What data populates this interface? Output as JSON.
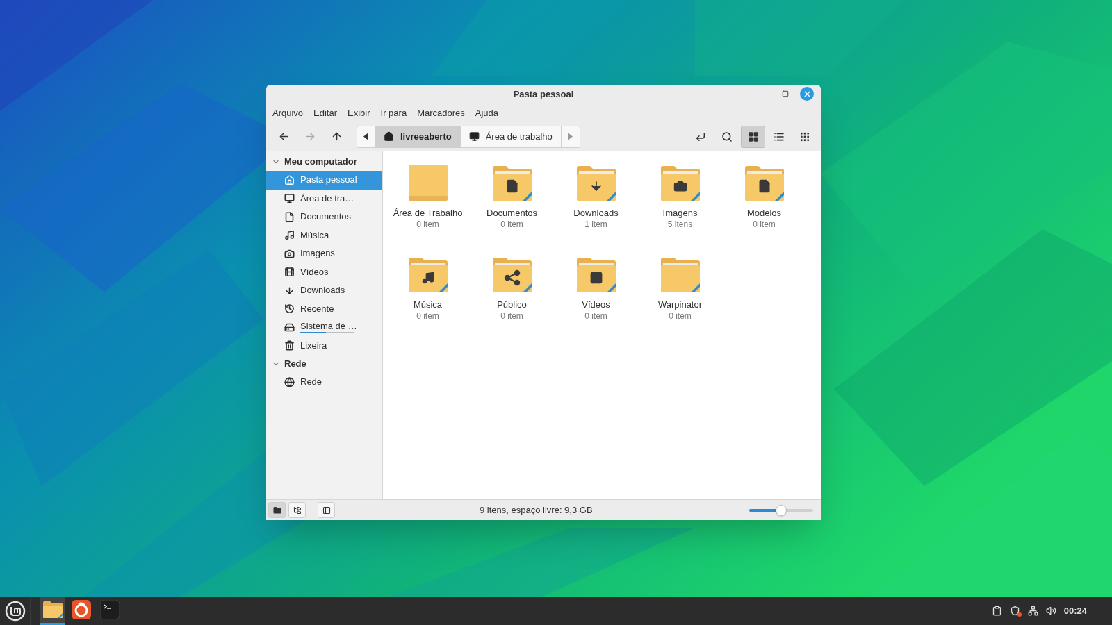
{
  "window": {
    "title": "Pasta pessoal"
  },
  "menu": [
    "Arquivo",
    "Editar",
    "Exibir",
    "Ir para",
    "Marcadores",
    "Ajuda"
  ],
  "navigation": [
    {
      "disabled": false
    },
    {
      "disabled": true
    },
    {
      "disabled": false
    }
  ],
  "path": [
    {
      "label": "livreeaberto",
      "selected": true
    },
    {
      "label": "Área de trabalho",
      "selected": false
    }
  ],
  "view_modes": [
    {
      "selected": true
    },
    {
      "selected": false
    },
    {
      "selected": false
    }
  ],
  "sidebar": [
    {
      "title": "Meu computador",
      "expanded": true,
      "items": [
        {
          "label": "Pasta pessoal",
          "selected": true
        },
        {
          "label": "Área de tra…",
          "selected": false
        },
        {
          "label": "Documentos",
          "selected": false
        },
        {
          "label": "Música",
          "selected": false
        },
        {
          "label": "Imagens",
          "selected": false
        },
        {
          "label": "Vídeos",
          "selected": false
        },
        {
          "label": "Downloads",
          "selected": false
        },
        {
          "label": "Recente",
          "selected": false
        },
        {
          "label": "Sistema de …",
          "selected": false,
          "level": 0.48
        },
        {
          "label": "Lixeira",
          "selected": false
        }
      ]
    },
    {
      "title": "Rede",
      "expanded": true,
      "items": [
        {
          "label": "Rede",
          "selected": false
        }
      ]
    }
  ],
  "files": [
    {
      "name": "Área de Trabalho",
      "count": "0 item"
    },
    {
      "name": "Documentos",
      "count": "0 item"
    },
    {
      "name": "Downloads",
      "count": "1 item"
    },
    {
      "name": "Imagens",
      "count": "5 itens"
    },
    {
      "name": "Modelos",
      "count": "0 item"
    },
    {
      "name": "Música",
      "count": "0 item"
    },
    {
      "name": "Público",
      "count": "0 item"
    },
    {
      "name": "Vídeos",
      "count": "0 item"
    },
    {
      "name": "Warpinator",
      "count": "0 item"
    }
  ],
  "status_bar": {
    "pane_buttons": [
      {
        "selected": true
      },
      {
        "selected": false
      }
    ],
    "text": "9 itens, espaço livre: 9,3 GB",
    "zoom": {
      "level": 0.5
    }
  },
  "taskbar": {
    "apps": [
      {
        "active": true
      },
      {
        "active": false
      },
      {
        "active": false
      }
    ],
    "clock": "00:24"
  }
}
